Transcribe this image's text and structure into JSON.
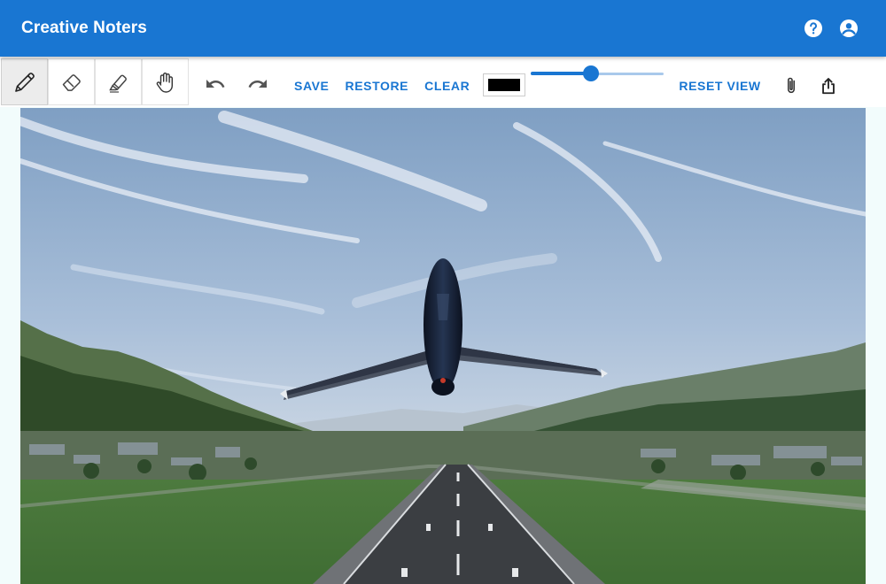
{
  "app": {
    "title": "Creative Noters"
  },
  "appbar": {
    "icons": [
      "help-icon",
      "account-icon"
    ]
  },
  "toolbar": {
    "tools": [
      {
        "name": "pencil",
        "icon": "pencil-icon",
        "active": true
      },
      {
        "name": "eraser",
        "icon": "eraser-icon",
        "active": false
      },
      {
        "name": "highlighter",
        "icon": "highlighter-icon",
        "active": false
      },
      {
        "name": "pan",
        "icon": "hand-icon",
        "active": false
      }
    ],
    "history": [
      "undo-icon",
      "redo-icon"
    ],
    "save_label": "SAVE",
    "restore_label": "RESTORE",
    "clear_label": "CLEAR",
    "stroke_color": "#000000",
    "brush_size_fraction": 0.45,
    "reset_view_label": "RESET VIEW",
    "right_icons": [
      "attach-icon",
      "share-icon"
    ]
  },
  "theme": {
    "primary": "#1976d2",
    "background": "#f2fcfc"
  }
}
